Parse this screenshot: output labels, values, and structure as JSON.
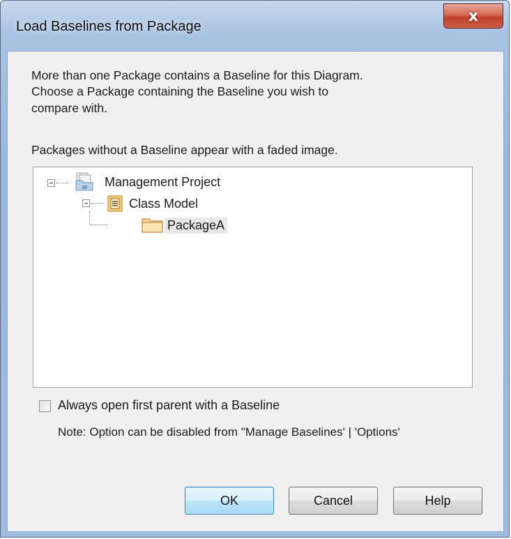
{
  "window": {
    "title": "Load Baselines from Package",
    "close_glyph": "x"
  },
  "description": {
    "line1": "More than one Package contains a Baseline for this Diagram.",
    "line2": "Choose a Package containing the Baseline you wish to",
    "line3": "compare with.",
    "faded_note": "Packages without a Baseline appear with a faded image."
  },
  "tree": {
    "nodes": [
      {
        "label": "Management Project",
        "icon": "model-root-icon",
        "level": 0,
        "expanded": true
      },
      {
        "label": "Class Model",
        "icon": "class-model-icon",
        "level": 1,
        "expanded": true
      },
      {
        "label": "PackageA",
        "icon": "package-folder-icon",
        "level": 2,
        "selected": true
      }
    ]
  },
  "options": {
    "checkbox_label": "Always open first parent with a Baseline",
    "checked": false,
    "note": "Note: Option can be disabled from \"Manage Baselines' | 'Options'"
  },
  "buttons": {
    "ok": "OK",
    "cancel": "Cancel",
    "help": "Help"
  },
  "colors": {
    "title_gradient": "#a9c3e3",
    "close_button": "#c95c44",
    "client_bg": "#f0f0f0",
    "default_button_border": "#3c7fb1"
  }
}
